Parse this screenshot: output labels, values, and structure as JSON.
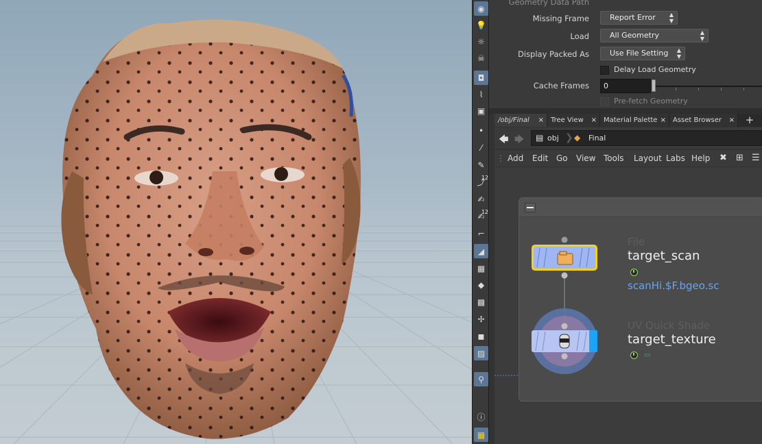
{
  "params": {
    "geometry_data_path_label": "Geometry Data Path",
    "missing_frame_label": "Missing Frame",
    "missing_frame_value": "Report Error",
    "load_label": "Load",
    "load_value": "All Geometry",
    "display_packed_label": "Display Packed As",
    "display_packed_value": "Use File Setting",
    "delay_load_label": "Delay Load Geometry",
    "cache_frames_label": "Cache Frames",
    "cache_frames_value": "0",
    "prefetch_label": "Pre-fetch Geometry"
  },
  "tabs": [
    {
      "label": "/obj/Final"
    },
    {
      "label": "Tree View"
    },
    {
      "label": "Material Palette"
    },
    {
      "label": "Asset Browser"
    }
  ],
  "path": {
    "crumbs": [
      "obj",
      "Final"
    ]
  },
  "menubar": {
    "items": [
      "Add",
      "Edit",
      "Go",
      "View",
      "Tools",
      "Layout",
      "Labs",
      "Help"
    ]
  },
  "nodes": [
    {
      "type": "File",
      "name": "target_scan",
      "parm": "scanHi.$F.bgeo.sc"
    },
    {
      "type": "UV Quick Shade",
      "name": "target_texture"
    }
  ],
  "colors": {
    "selection_yellow": "#f1d21c",
    "node_blue": "#9fb6f2",
    "link_blue": "#6aa4ea",
    "display_flag": "#1ea4f4"
  }
}
